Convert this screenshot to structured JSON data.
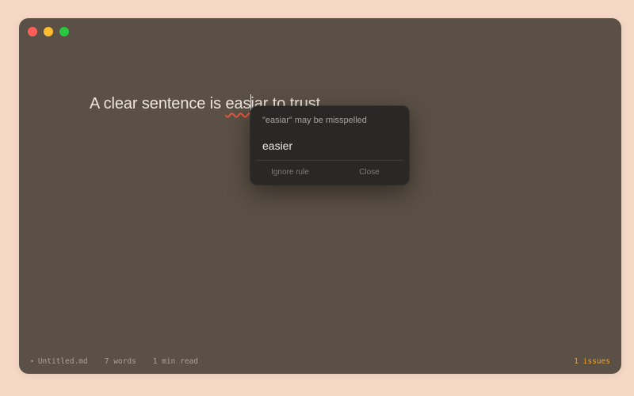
{
  "editor": {
    "before": "A clear sentence is ",
    "misspelled_a": "eas",
    "misspelled_b": "iar",
    "after": " to trust",
    "trailing": "."
  },
  "popover": {
    "message": "\"easiar\" may be misspelled",
    "suggestion": "easier",
    "ignore_label": "Ignore rule",
    "close_label": "Close"
  },
  "status": {
    "bullet": "•",
    "filename": "Untitled.md",
    "words": "7 words",
    "read_time": "1 min read",
    "issues": "1 issues"
  },
  "colors": {
    "accent_issues": "#e8a33a",
    "spell_underline": "#e8553f",
    "window_bg": "#5a5045",
    "desktop_bg": "#f5d9c6"
  }
}
